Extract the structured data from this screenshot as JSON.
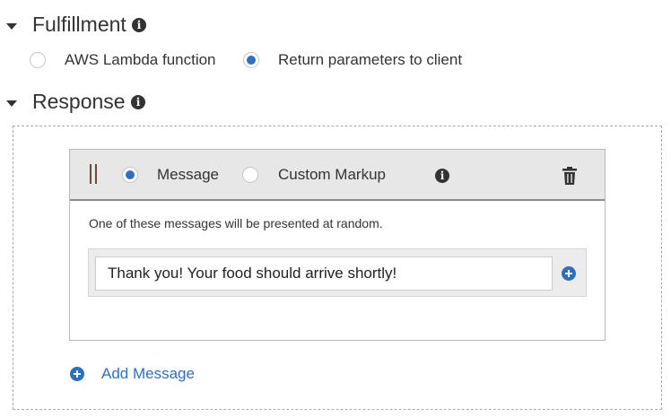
{
  "fulfillment": {
    "title": "Fulfillment",
    "options": [
      {
        "label": "AWS Lambda function",
        "selected": false
      },
      {
        "label": "Return parameters to client",
        "selected": true
      }
    ]
  },
  "response": {
    "title": "Response",
    "card": {
      "type_options": [
        {
          "label": "Message",
          "selected": true
        },
        {
          "label": "Custom Markup",
          "selected": false
        }
      ],
      "hint": "One of these messages will be presented at random.",
      "messages": [
        "Thank you! Your food should arrive shortly!"
      ]
    },
    "add_message_label": "Add Message"
  },
  "colors": {
    "accent": "#2f6fbf",
    "text": "#333333",
    "header_bg": "#e7e7e7"
  }
}
